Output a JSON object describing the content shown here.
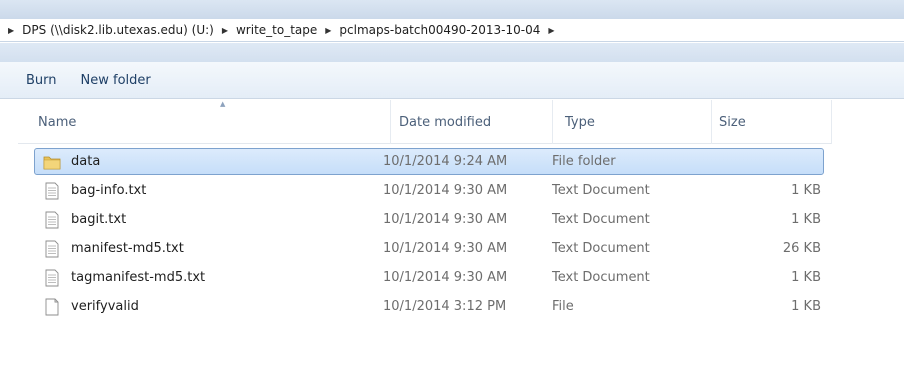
{
  "address": {
    "crumbs": [
      "DPS (\\\\disk2.lib.utexas.edu) (U:)",
      "write_to_tape",
      "pclmaps-batch00490-2013-10-04"
    ]
  },
  "toolbar": {
    "burn_label": "Burn",
    "new_folder_label": "New folder"
  },
  "columns": {
    "name": "Name",
    "date": "Date modified",
    "type": "Type",
    "size": "Size"
  },
  "files": [
    {
      "name": "data",
      "date": "10/1/2014 9:24 AM",
      "type": "File folder",
      "size": "",
      "icon": "folder-icon",
      "selected": true
    },
    {
      "name": "bag-info.txt",
      "date": "10/1/2014 9:30 AM",
      "type": "Text Document",
      "size": "1 KB",
      "icon": "text-file-icon"
    },
    {
      "name": "bagit.txt",
      "date": "10/1/2014 9:30 AM",
      "type": "Text Document",
      "size": "1 KB",
      "icon": "text-file-icon"
    },
    {
      "name": "manifest-md5.txt",
      "date": "10/1/2014 9:30 AM",
      "type": "Text Document",
      "size": "26 KB",
      "icon": "text-file-icon"
    },
    {
      "name": "tagmanifest-md5.txt",
      "date": "10/1/2014 9:30 AM",
      "type": "Text Document",
      "size": "1 KB",
      "icon": "text-file-icon"
    },
    {
      "name": "verifyvalid",
      "date": "10/1/2014 3:12 PM",
      "type": "File",
      "size": "1 KB",
      "icon": "blank-file-icon"
    }
  ],
  "colors": {
    "selection": "#cce4fb",
    "selection_border": "#7da2ce",
    "header_text": "#4c607a",
    "folder": "#e8c35a"
  }
}
